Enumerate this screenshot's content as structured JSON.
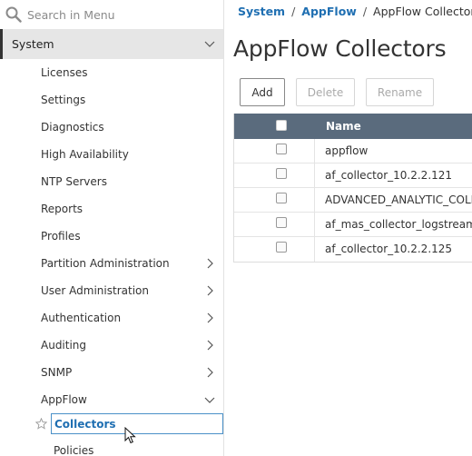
{
  "search": {
    "placeholder": "Search in Menu"
  },
  "sidebar": {
    "section": "System",
    "items": [
      {
        "label": "Licenses"
      },
      {
        "label": "Settings"
      },
      {
        "label": "Diagnostics"
      },
      {
        "label": "High Availability"
      },
      {
        "label": "NTP Servers"
      },
      {
        "label": "Reports"
      },
      {
        "label": "Profiles"
      },
      {
        "label": "Partition Administration"
      },
      {
        "label": "User Administration"
      },
      {
        "label": "Authentication"
      },
      {
        "label": "Auditing"
      },
      {
        "label": "SNMP"
      },
      {
        "label": "AppFlow"
      }
    ],
    "appflow_children": [
      {
        "label": "Collectors"
      },
      {
        "label": "Policies"
      }
    ]
  },
  "breadcrumb": {
    "root": "System",
    "parent": "AppFlow",
    "current": "AppFlow Collectors",
    "separator": "/"
  },
  "page": {
    "title": "AppFlow Collectors"
  },
  "toolbar": {
    "add_label": "Add",
    "delete_label": "Delete",
    "rename_label": "Rename"
  },
  "table": {
    "columns": [
      "Name"
    ],
    "rows": [
      {
        "name": "appflow"
      },
      {
        "name": "af_collector_10.2.2.121"
      },
      {
        "name": "ADVANCED_ANALYTIC_COLLE"
      },
      {
        "name": "af_mas_collector_logstream_"
      },
      {
        "name": "af_collector_10.2.2.125"
      }
    ]
  },
  "colors": {
    "link": "#1f6fb2",
    "table_header": "#5a6b7d",
    "selected_row": "#e6e6e6"
  }
}
